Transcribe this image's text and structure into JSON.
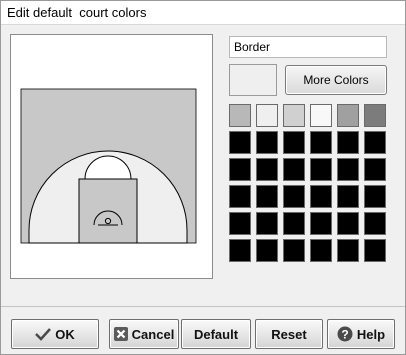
{
  "window": {
    "title": "Edit default  court colors"
  },
  "color_editor": {
    "name_field_value": "Border",
    "preview_color": "#efefef",
    "more_colors_label": "More Colors",
    "palette": [
      [
        "#b8b8b8",
        "#efefef",
        "#d0d0d0",
        "#f8f8f8",
        "#a0a0a0",
        "#7c7c7c"
      ],
      [
        "#000000",
        "#000000",
        "#000000",
        "#000000",
        "#000000",
        "#000000"
      ],
      [
        "#000000",
        "#000000",
        "#000000",
        "#000000",
        "#000000",
        "#000000"
      ],
      [
        "#000000",
        "#000000",
        "#000000",
        "#000000",
        "#000000",
        "#000000"
      ],
      [
        "#000000",
        "#000000",
        "#000000",
        "#000000",
        "#000000",
        "#000000"
      ],
      [
        "#000000",
        "#000000",
        "#000000",
        "#000000",
        "#000000",
        "#000000"
      ]
    ]
  },
  "court": {
    "floor_color": "#c8c8c8",
    "border_color": "#efefef",
    "line_color": "#000000",
    "lane_color": "#c8c8c8"
  },
  "buttons": {
    "ok": {
      "label": "OK",
      "icon": "check-icon"
    },
    "cancel": {
      "label": "Cancel",
      "icon": "x-icon"
    },
    "default": {
      "label": "Default"
    },
    "reset": {
      "label": "Reset"
    },
    "help": {
      "label": "Help",
      "icon": "question-icon"
    }
  }
}
